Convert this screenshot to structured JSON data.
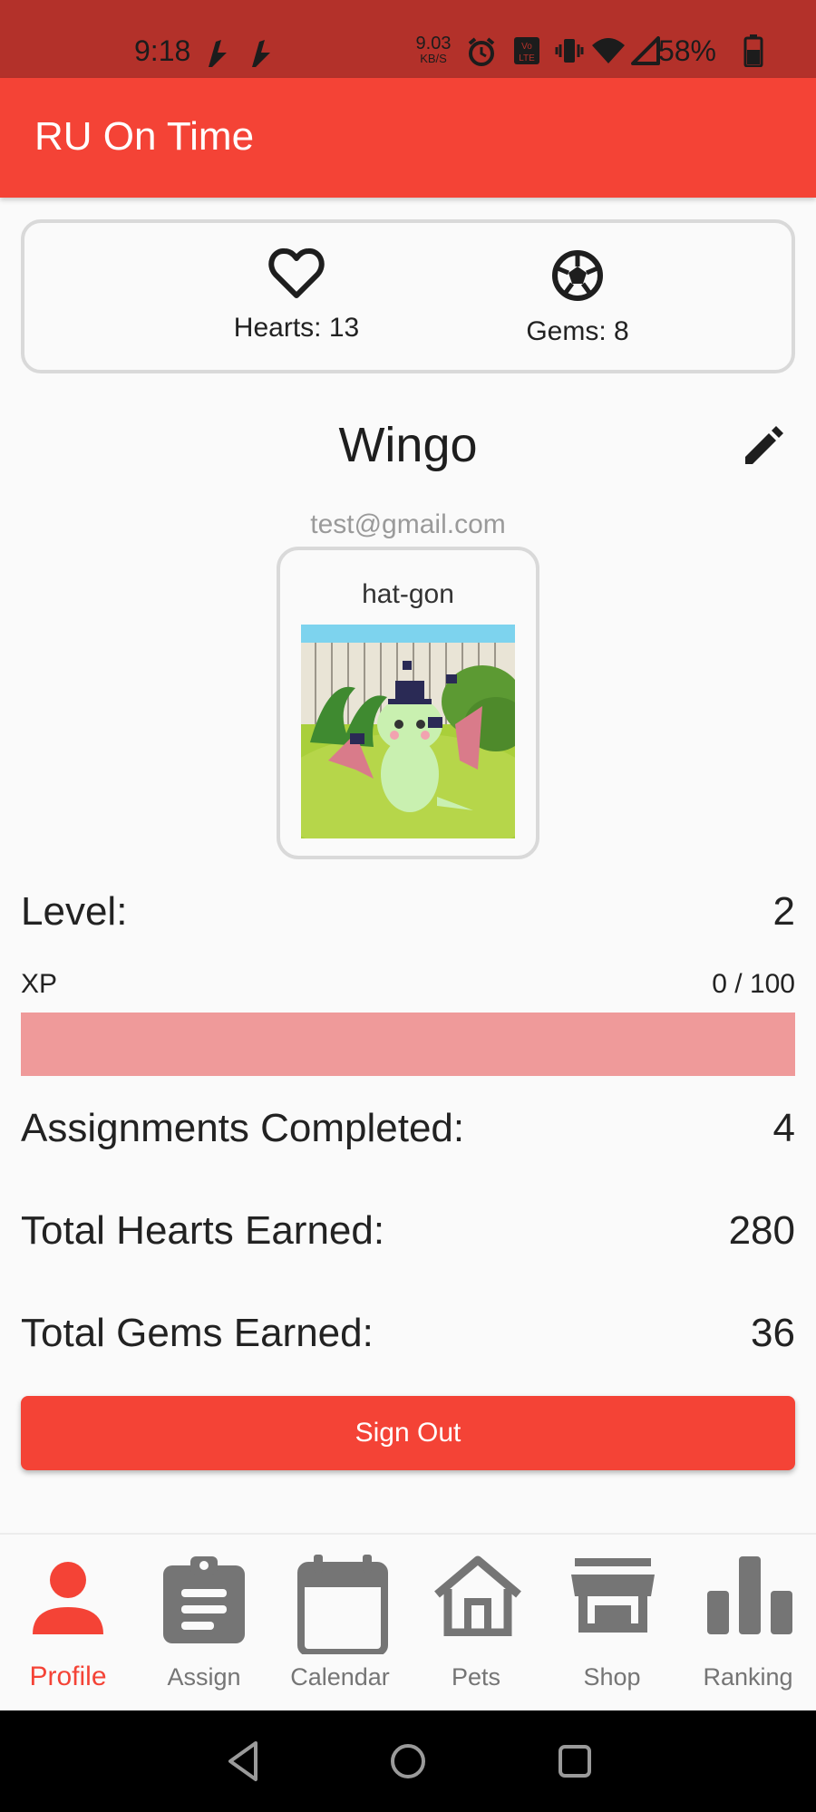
{
  "status_bar": {
    "time": "9:18",
    "net_speed": "9.03",
    "net_unit": "KB/S",
    "battery": "58%"
  },
  "app_bar": {
    "title": "RU On Time"
  },
  "currency": {
    "hearts_label": "Hearts: 13",
    "gems_label": "Gems: 8"
  },
  "profile": {
    "username": "Wingo",
    "email": "test@gmail.com",
    "pet_name": "hat-gon"
  },
  "stats": {
    "level_label": "Level:",
    "level_value": "2",
    "xp_label": "XP",
    "xp_value": "0 / 100",
    "xp_progress": 0,
    "assignments_label": "Assignments Completed:",
    "assignments_value": "4",
    "hearts_label": "Total Hearts Earned:",
    "hearts_value": "280",
    "gems_label": "Total Gems Earned:",
    "gems_value": "36"
  },
  "sign_out_label": "Sign Out",
  "nav": {
    "items": [
      {
        "label": "Profile",
        "icon": "person-icon",
        "active": true
      },
      {
        "label": "Assign",
        "icon": "clipboard-icon",
        "active": false
      },
      {
        "label": "Calendar",
        "icon": "calendar-icon",
        "active": false
      },
      {
        "label": "Pets",
        "icon": "house-icon",
        "active": false
      },
      {
        "label": "Shop",
        "icon": "store-icon",
        "active": false
      },
      {
        "label": "Ranking",
        "icon": "bar-chart-icon",
        "active": false
      }
    ]
  },
  "colors": {
    "primary": "#f44336",
    "status_bar": "#b3312a",
    "xp_track": "#ef9a9a",
    "nav_inactive": "#757575"
  }
}
